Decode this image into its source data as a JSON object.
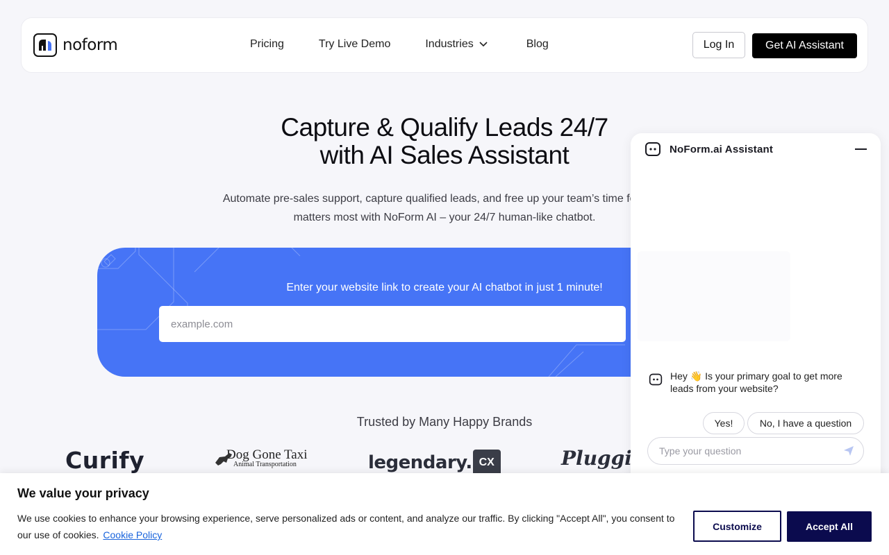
{
  "header": {
    "logo_text": "noform",
    "nav": [
      {
        "label": "Pricing"
      },
      {
        "label": "Try Live Demo"
      },
      {
        "label": "Industries",
        "has_dropdown": true
      },
      {
        "label": "Blog"
      }
    ],
    "login_label": "Log In",
    "cta_label": "Get AI Assistant"
  },
  "hero": {
    "title_line1": "Capture & Qualify Leads 24/7",
    "title_line2": "with AI Sales Assistant",
    "subtitle_line1": "Automate pre-sales support, capture qualified leads, and free up your team’s time for what",
    "subtitle_line2": "matters most with NoForm AI – your 24/7 human-like chatbot."
  },
  "cta_card": {
    "label": "Enter your website link to create your AI chatbot in just 1 minute!",
    "input_placeholder": "example.com",
    "background_color": "#4674f6"
  },
  "brands": {
    "heading": "Trusted by Many Happy Brands",
    "items": [
      {
        "name": "Curify"
      },
      {
        "name": "Dog Gone Taxi",
        "tagline": "Animal Transportation"
      },
      {
        "name": "legendary.",
        "badge": "CX"
      },
      {
        "name": "Pluggi"
      }
    ]
  },
  "chat_widget": {
    "title": "NoForm.ai Assistant",
    "bot_message": "Hey 👋 Is your primary goal to get more leads from your website?",
    "quick_replies": [
      "Yes!",
      "No, I have a question"
    ],
    "input_placeholder": "Type your question"
  },
  "cookie_banner": {
    "title": "We value your privacy",
    "text": "We use cookies to enhance your browsing experience, serve personalized ads or content, and analyze our traffic. By clicking \"Accept All\", you consent to our use of cookies.",
    "link_label": "Cookie Policy",
    "customize_label": "Customize",
    "accept_label": "Accept All",
    "accent_color": "#0b0b4e"
  }
}
